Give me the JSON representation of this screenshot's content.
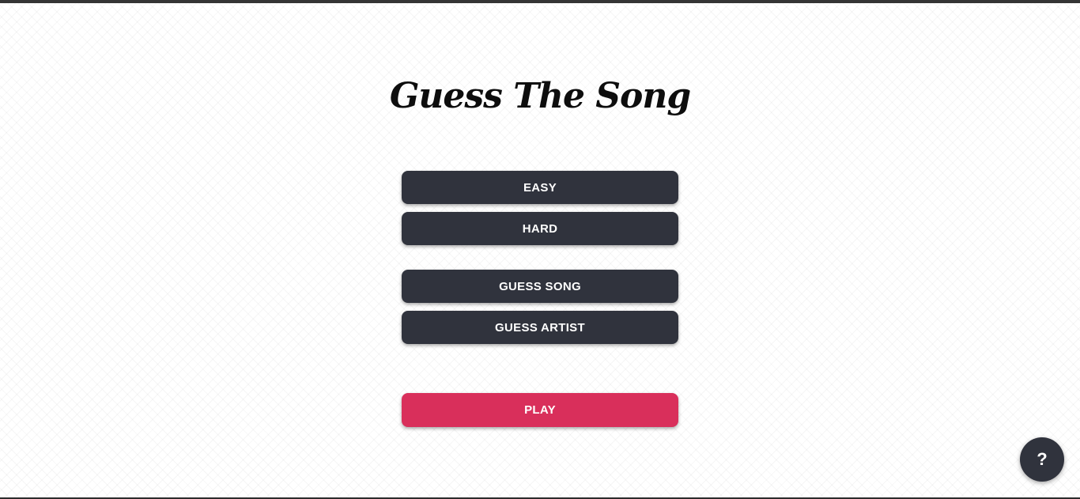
{
  "app": {
    "title": "Guess The Song"
  },
  "difficulty": {
    "easy_label": "EASY",
    "hard_label": "HARD"
  },
  "mode": {
    "guess_song_label": "GUESS SONG",
    "guess_artist_label": "GUESS ARTIST"
  },
  "actions": {
    "play_label": "PLAY",
    "help_label": "?"
  },
  "colors": {
    "button_dark": "#30333d",
    "play_accent": "#d92f5b",
    "background": "#ffffff"
  }
}
